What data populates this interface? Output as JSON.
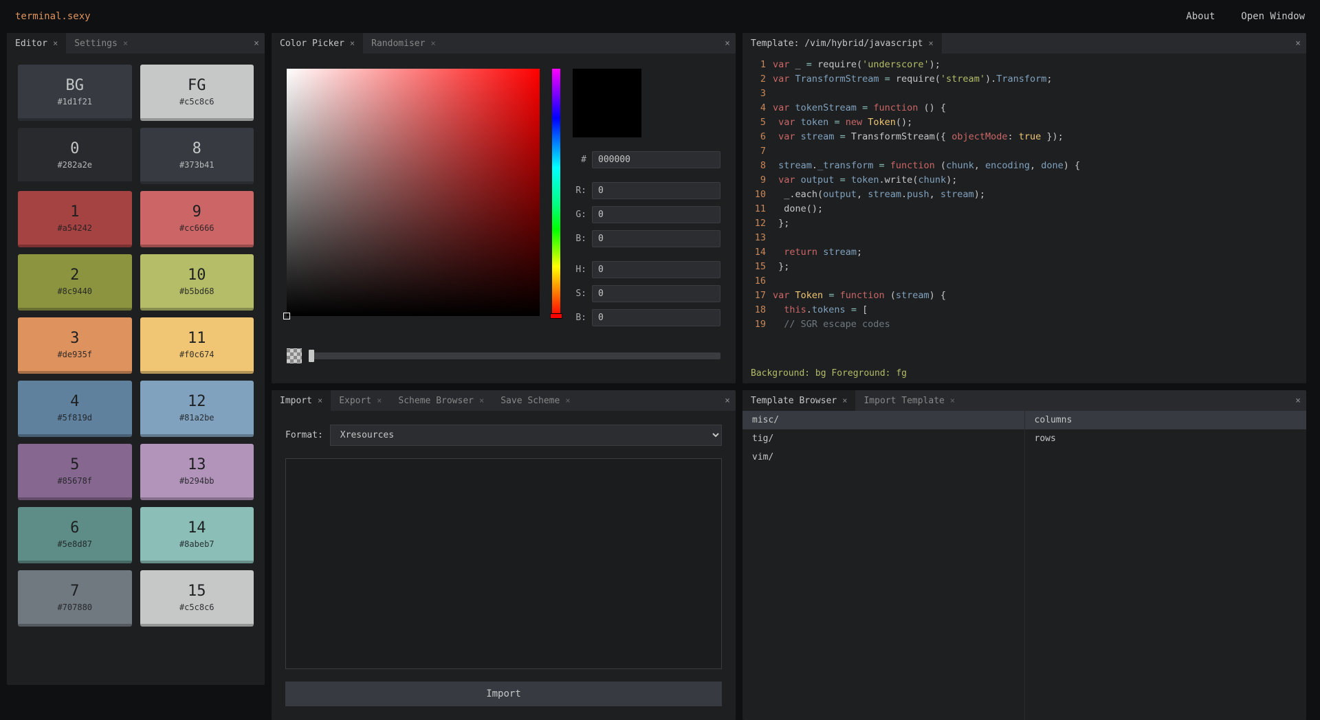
{
  "brand": "terminal.sexy",
  "top": {
    "about": "About",
    "open_window": "Open Window"
  },
  "editor": {
    "tabs": [
      {
        "label": "Editor",
        "active": true
      },
      {
        "label": "Settings",
        "active": false
      }
    ],
    "swatches": [
      {
        "id": "BG",
        "hex": "#1d1f21",
        "bg": "#373b41",
        "fg": "#c5c8c6"
      },
      {
        "id": "FG",
        "hex": "#c5c8c6",
        "bg": "#c5c8c6",
        "fg": "#1d1f21"
      },
      {
        "id": "0",
        "hex": "#282a2e",
        "bg": "#282a2e",
        "fg": "#c5c8c6"
      },
      {
        "id": "8",
        "hex": "#373b41",
        "bg": "#373b41",
        "fg": "#c5c8c6"
      },
      {
        "id": "1",
        "hex": "#a54242",
        "bg": "#a54242",
        "fg": "#1d1f21"
      },
      {
        "id": "9",
        "hex": "#cc6666",
        "bg": "#cc6666",
        "fg": "#1d1f21"
      },
      {
        "id": "2",
        "hex": "#8c9440",
        "bg": "#8c9440",
        "fg": "#1d1f21"
      },
      {
        "id": "10",
        "hex": "#b5bd68",
        "bg": "#b5bd68",
        "fg": "#1d1f21"
      },
      {
        "id": "3",
        "hex": "#de935f",
        "bg": "#de935f",
        "fg": "#1d1f21"
      },
      {
        "id": "11",
        "hex": "#f0c674",
        "bg": "#f0c674",
        "fg": "#1d1f21"
      },
      {
        "id": "4",
        "hex": "#5f819d",
        "bg": "#5f819d",
        "fg": "#1d1f21"
      },
      {
        "id": "12",
        "hex": "#81a2be",
        "bg": "#81a2be",
        "fg": "#1d1f21"
      },
      {
        "id": "5",
        "hex": "#85678f",
        "bg": "#85678f",
        "fg": "#1d1f21"
      },
      {
        "id": "13",
        "hex": "#b294bb",
        "bg": "#b294bb",
        "fg": "#1d1f21"
      },
      {
        "id": "6",
        "hex": "#5e8d87",
        "bg": "#5e8d87",
        "fg": "#1d1f21"
      },
      {
        "id": "14",
        "hex": "#8abeb7",
        "bg": "#8abeb7",
        "fg": "#1d1f21"
      },
      {
        "id": "7",
        "hex": "#707880",
        "bg": "#707880",
        "fg": "#1d1f21"
      },
      {
        "id": "15",
        "hex": "#c5c8c6",
        "bg": "#c5c8c6",
        "fg": "#1d1f21"
      }
    ]
  },
  "picker": {
    "tabs": [
      {
        "label": "Color Picker",
        "active": true
      },
      {
        "label": "Randomiser",
        "active": false
      }
    ],
    "hex_prefix": "#",
    "hex": "000000",
    "r_label": "R:",
    "r": "0",
    "g_label": "G:",
    "g": "0",
    "b_label": "B:",
    "b": "0",
    "h_label": "H:",
    "h": "0",
    "s_label": "S:",
    "s": "0",
    "v_label": "B:",
    "v": "0"
  },
  "template": {
    "tab_label": "Template: /vim/hybrid/javascript",
    "status": "Background: bg Foreground: fg",
    "lines": [
      [
        [
          "kw",
          "var"
        ],
        [
          "pun",
          " _ "
        ],
        [
          "op",
          "="
        ],
        [
          "pun",
          " "
        ],
        [
          "fn",
          "require"
        ],
        [
          "pun",
          "("
        ],
        [
          "str",
          "'underscore'"
        ],
        [
          "pun",
          ");"
        ]
      ],
      [
        [
          "kw",
          "var"
        ],
        [
          "pun",
          " "
        ],
        [
          "var",
          "TransformStream"
        ],
        [
          "pun",
          " "
        ],
        [
          "op",
          "="
        ],
        [
          "pun",
          " "
        ],
        [
          "fn",
          "require"
        ],
        [
          "pun",
          "("
        ],
        [
          "str",
          "'stream'"
        ],
        [
          "pun",
          ")."
        ],
        [
          "var",
          "Transform"
        ],
        [
          "pun",
          ";"
        ]
      ],
      [],
      [
        [
          "kw",
          "var"
        ],
        [
          "pun",
          " "
        ],
        [
          "var",
          "tokenStream"
        ],
        [
          "pun",
          " "
        ],
        [
          "op",
          "="
        ],
        [
          "pun",
          " "
        ],
        [
          "kw",
          "function"
        ],
        [
          "pun",
          " () {"
        ]
      ],
      [
        [
          "pun",
          " "
        ],
        [
          "kw",
          "var"
        ],
        [
          "pun",
          " "
        ],
        [
          "var",
          "token"
        ],
        [
          "pun",
          " "
        ],
        [
          "op",
          "="
        ],
        [
          "pun",
          " "
        ],
        [
          "kw",
          "new"
        ],
        [
          "pun",
          " "
        ],
        [
          "name",
          "Token"
        ],
        [
          "pun",
          "();"
        ]
      ],
      [
        [
          "pun",
          " "
        ],
        [
          "kw",
          "var"
        ],
        [
          "pun",
          " "
        ],
        [
          "var",
          "stream"
        ],
        [
          "pun",
          " "
        ],
        [
          "op",
          "="
        ],
        [
          "pun",
          " "
        ],
        [
          "fn",
          "TransformStream"
        ],
        [
          "pun",
          "({ "
        ],
        [
          "field",
          "objectMode"
        ],
        [
          "pun",
          ": "
        ],
        [
          "bool",
          "true"
        ],
        [
          "pun",
          " });"
        ]
      ],
      [],
      [
        [
          "pun",
          " "
        ],
        [
          "var",
          "stream"
        ],
        [
          "pun",
          "."
        ],
        [
          "var",
          "_transform"
        ],
        [
          "pun",
          " "
        ],
        [
          "op",
          "="
        ],
        [
          "pun",
          " "
        ],
        [
          "kw",
          "function"
        ],
        [
          "pun",
          " ("
        ],
        [
          "var",
          "chunk"
        ],
        [
          "pun",
          ", "
        ],
        [
          "var",
          "encoding"
        ],
        [
          "pun",
          ", "
        ],
        [
          "var",
          "done"
        ],
        [
          "pun",
          ") {"
        ]
      ],
      [
        [
          "pun",
          " "
        ],
        [
          "kw",
          "var"
        ],
        [
          "pun",
          " "
        ],
        [
          "var",
          "output"
        ],
        [
          "pun",
          " "
        ],
        [
          "op",
          "="
        ],
        [
          "pun",
          " "
        ],
        [
          "var",
          "token"
        ],
        [
          "pun",
          "."
        ],
        [
          "fn",
          "write"
        ],
        [
          "pun",
          "("
        ],
        [
          "var",
          "chunk"
        ],
        [
          "pun",
          ");"
        ]
      ],
      [
        [
          "pun",
          "  _."
        ],
        [
          "fn",
          "each"
        ],
        [
          "pun",
          "("
        ],
        [
          "var",
          "output"
        ],
        [
          "pun",
          ", "
        ],
        [
          "var",
          "stream"
        ],
        [
          "pun",
          "."
        ],
        [
          "var",
          "push"
        ],
        [
          "pun",
          ", "
        ],
        [
          "var",
          "stream"
        ],
        [
          "pun",
          ");"
        ]
      ],
      [
        [
          "pun",
          "  "
        ],
        [
          "fn",
          "done"
        ],
        [
          "pun",
          "();"
        ]
      ],
      [
        [
          "pun",
          " };"
        ]
      ],
      [],
      [
        [
          "pun",
          "  "
        ],
        [
          "kw",
          "return"
        ],
        [
          "pun",
          " "
        ],
        [
          "var",
          "stream"
        ],
        [
          "pun",
          ";"
        ]
      ],
      [
        [
          "pun",
          " };"
        ]
      ],
      [],
      [
        [
          "kw",
          "var"
        ],
        [
          "pun",
          " "
        ],
        [
          "name",
          "Token"
        ],
        [
          "pun",
          " "
        ],
        [
          "op",
          "="
        ],
        [
          "pun",
          " "
        ],
        [
          "kw",
          "function"
        ],
        [
          "pun",
          " ("
        ],
        [
          "var",
          "stream"
        ],
        [
          "pun",
          ") {"
        ]
      ],
      [
        [
          "pun",
          "  "
        ],
        [
          "kw",
          "this"
        ],
        [
          "pun",
          "."
        ],
        [
          "var",
          "tokens"
        ],
        [
          "pun",
          " "
        ],
        [
          "op",
          "="
        ],
        [
          "pun",
          " ["
        ]
      ],
      [
        [
          "pun",
          "  "
        ],
        [
          "cmt",
          "// SGR escape codes"
        ]
      ]
    ]
  },
  "import": {
    "tabs": [
      {
        "label": "Import",
        "active": true
      },
      {
        "label": "Export",
        "active": false
      },
      {
        "label": "Scheme Browser",
        "active": false
      },
      {
        "label": "Save Scheme",
        "active": false
      }
    ],
    "format_label": "Format:",
    "format_value": "Xresources",
    "textarea": "",
    "button": "Import"
  },
  "tbrowser": {
    "tabs": [
      {
        "label": "Template Browser",
        "active": true
      },
      {
        "label": "Import Template",
        "active": false
      }
    ],
    "col1": [
      {
        "label": "misc/",
        "sel": true
      },
      {
        "label": "tig/",
        "sel": false
      },
      {
        "label": "vim/",
        "sel": false
      }
    ],
    "col2": [
      {
        "label": "columns",
        "sel": true
      },
      {
        "label": "rows",
        "sel": false
      }
    ]
  }
}
